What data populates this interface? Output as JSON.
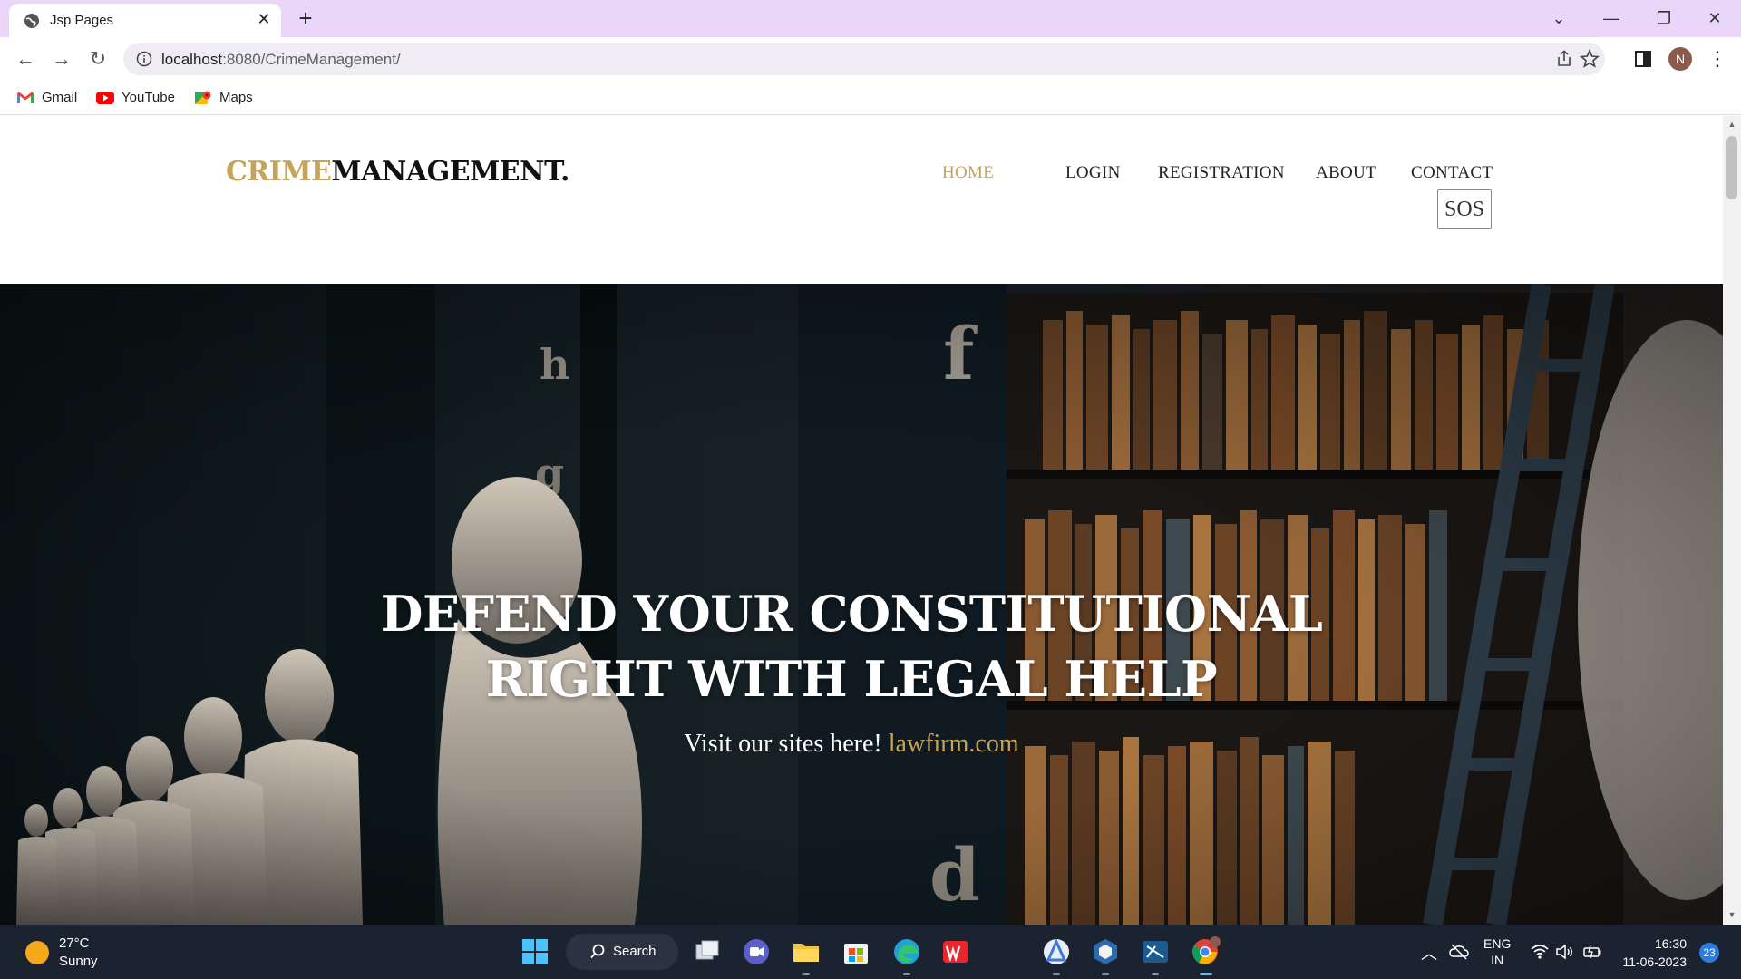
{
  "browser": {
    "tab_title": "Jsp Pages",
    "url_host": "localhost",
    "url_rest": ":8080/CrimeManagement/",
    "bookmarks": [
      {
        "label": "Gmail",
        "icon": "gmail-icon"
      },
      {
        "label": "YouTube",
        "icon": "youtube-icon"
      },
      {
        "label": "Maps",
        "icon": "maps-icon"
      }
    ],
    "profile_initial": "N"
  },
  "site": {
    "logo_part1": "CRIME",
    "logo_part2": "MANAGEMENT.",
    "nav": {
      "home": "HOME",
      "login": "LOGIN",
      "registration": "REGISTRATION",
      "about": "ABOUT",
      "contact": "CONTACT"
    },
    "sos_label": "SOS",
    "hero": {
      "title_line1": "DEFEND YOUR CONSTITUTIONAL",
      "title_line2": "RIGHT WITH LEGAL HELP",
      "subtitle_text": "Visit our sites here! ",
      "subtitle_link": "lawfirm.com"
    }
  },
  "taskbar": {
    "weather_temp": "27°C",
    "weather_condition": "Sunny",
    "search_label": "Search",
    "language_line1": "ENG",
    "language_line2": "IN",
    "time": "16:30",
    "date": "11-06-2023",
    "notification_count": "23"
  },
  "colors": {
    "accent_gold": "#c5a35a",
    "tabbar": "#e9d6f8",
    "taskbar": "#1c2330"
  }
}
